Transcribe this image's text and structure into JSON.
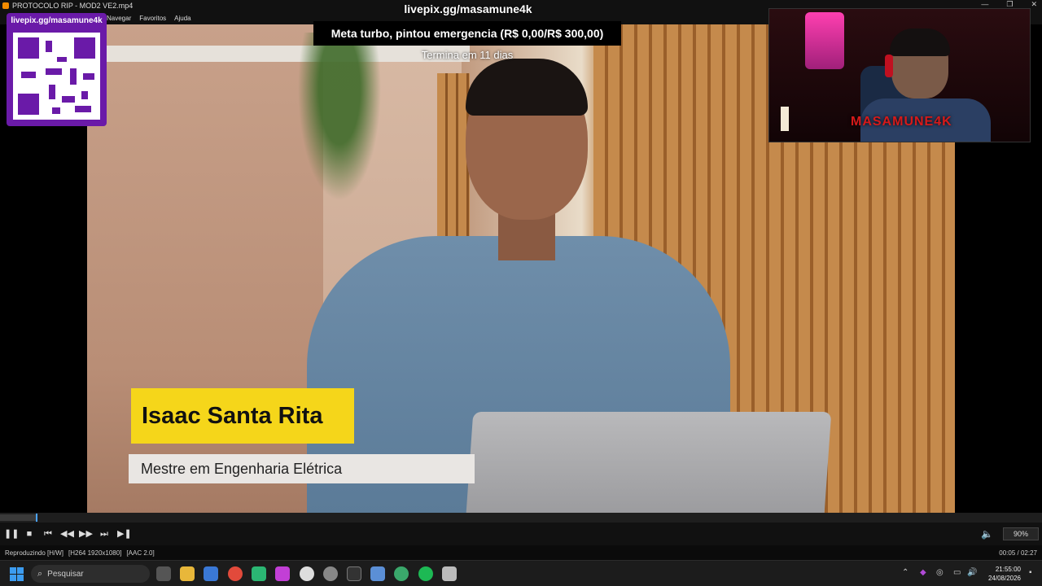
{
  "window": {
    "title": "PROTOCOLO RIP - MOD2 VE2.mp4",
    "controls": [
      "—",
      "❐",
      "✕"
    ]
  },
  "menu": {
    "items": [
      "Navegar",
      "Favoritos",
      "Ajuda"
    ]
  },
  "overlay": {
    "livepix_url": "livepix.gg/masamune4k",
    "qr_label": "livepix.gg/masamune4k",
    "goal_text": "Meta turbo, pintou emergencia (R$ 0,00/R$ 300,00)",
    "goal_sub": "Termina em 11 dias",
    "webcam_brand": "MASAMUNE4K"
  },
  "lower_third": {
    "name": "Isaac Santa Rita",
    "title": "Mestre em Engenharia Elétrica"
  },
  "player": {
    "progress": 0.034,
    "volume": "90%",
    "status_playing": "Reproduzindo [H/W]",
    "status_codec": "[H264 1920x1080]",
    "status_audio": "[AAC 2.0]",
    "time": "00:05 / 02:27",
    "buttons": {
      "pause": "❚❚",
      "stop": "■",
      "prev": "⏮",
      "rewind": "◀◀",
      "forward": "▶▶",
      "next": "⏭",
      "frame_step": "▶❚"
    }
  },
  "taskbar": {
    "search_placeholder": "Pesquisar",
    "clock_time": "21:55:00",
    "clock_date": "24/08/2026"
  },
  "colors": {
    "accent_purple": "#6a1aa8",
    "lower_third_yellow": "#f5d61a",
    "seek_thumb": "#4aa3ff"
  }
}
